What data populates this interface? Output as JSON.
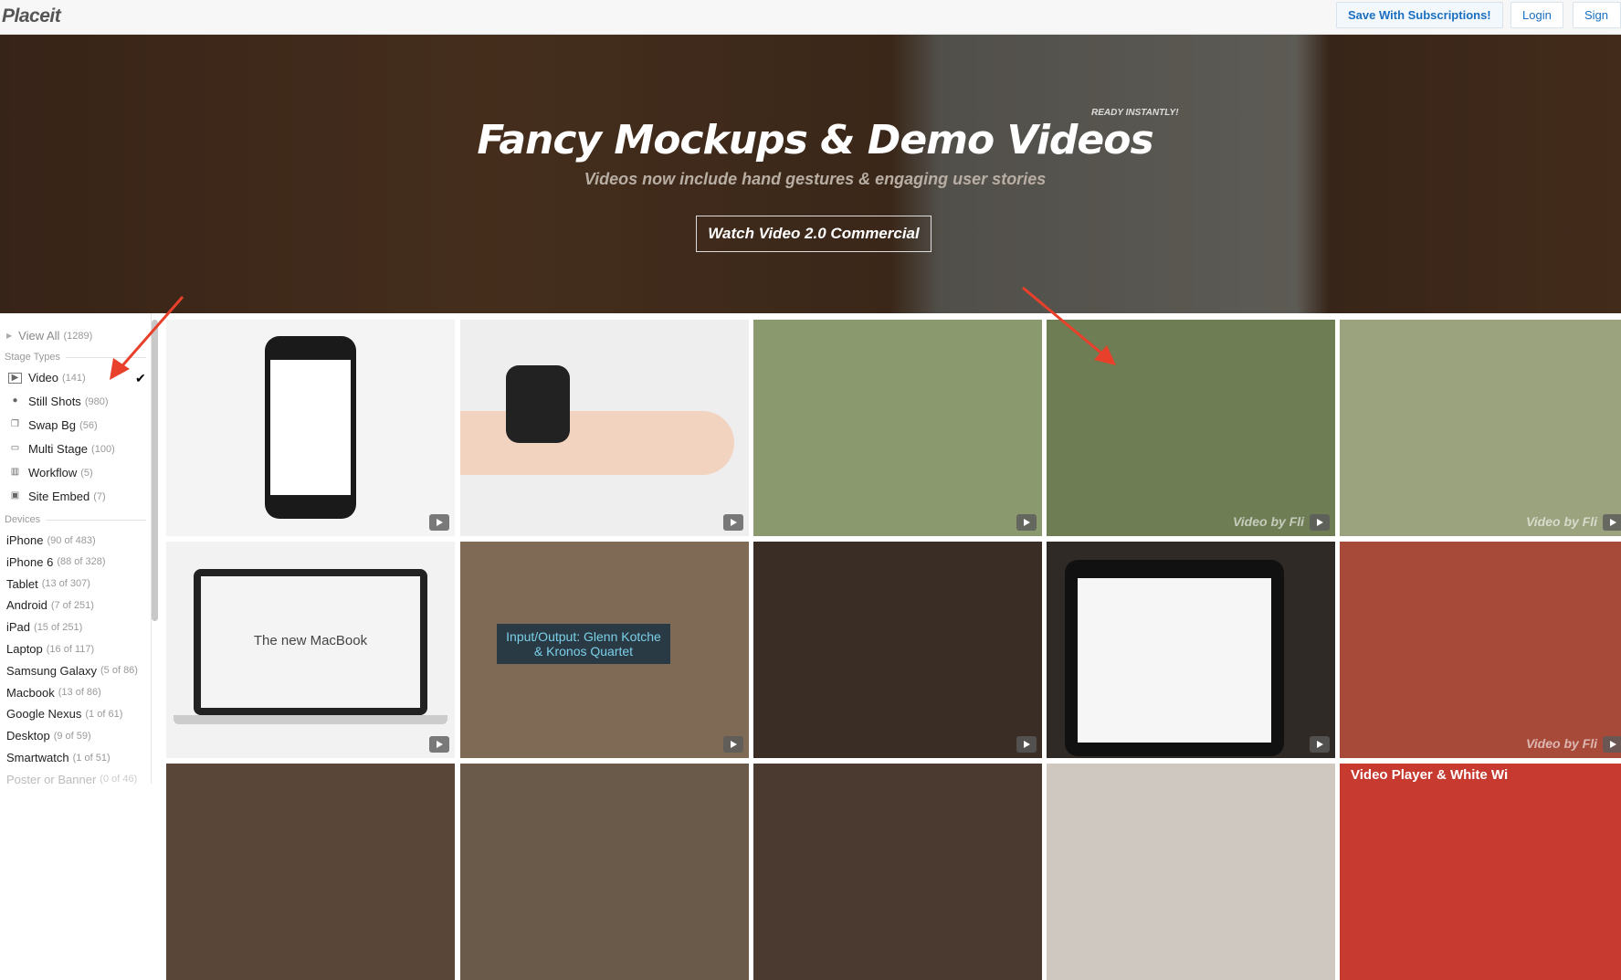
{
  "header": {
    "logo": "Placeit",
    "save_button": "Save With Subscriptions!",
    "login_button": "Login",
    "signup_button": "Sign Up"
  },
  "hero": {
    "badge": "READY INSTANTLY!",
    "title": "Fancy Mockups & Demo Videos",
    "subtitle": "Videos now include hand gestures & engaging user stories",
    "cta": "Watch Video 2.0 Commercial"
  },
  "sidebar": {
    "view_all": {
      "label": "View All",
      "count": "(1289)"
    },
    "stage_types_heading": "Stage Types",
    "stage_types": [
      {
        "label": "Video",
        "count": "(141)",
        "icon": "video-icon",
        "selected": true
      },
      {
        "label": "Still Shots",
        "count": "(980)",
        "icon": "camera-icon"
      },
      {
        "label": "Swap Bg",
        "count": "(56)",
        "icon": "layers-icon"
      },
      {
        "label": "Multi Stage",
        "count": "(100)",
        "icon": "devices-icon"
      },
      {
        "label": "Workflow",
        "count": "(5)",
        "icon": "film-icon"
      },
      {
        "label": "Site Embed",
        "count": "(7)",
        "icon": "monitor-icon"
      }
    ],
    "devices_heading": "Devices",
    "devices": [
      {
        "label": "iPhone",
        "count": "(90 of 483)"
      },
      {
        "label": "iPhone 6",
        "count": "(88 of 328)"
      },
      {
        "label": "Tablet",
        "count": "(13 of 307)"
      },
      {
        "label": "Android",
        "count": "(7 of 251)"
      },
      {
        "label": "iPad",
        "count": "(15 of 251)"
      },
      {
        "label": "Laptop",
        "count": "(16 of 117)"
      },
      {
        "label": "Samsung Galaxy",
        "count": "(5 of 86)"
      },
      {
        "label": "Macbook",
        "count": "(13 of 86)"
      },
      {
        "label": "Google Nexus",
        "count": "(1 of 61)"
      },
      {
        "label": "Desktop",
        "count": "(9 of 59)"
      },
      {
        "label": "Smartwatch",
        "count": "(1 of 51)"
      },
      {
        "label": "Poster or Banner",
        "count": "(0 of 46)",
        "disabled": true
      }
    ]
  },
  "grid": {
    "tiles": [
      {
        "bg": "#f4f4f4",
        "text": ""
      },
      {
        "bg": "#eeeeee",
        "text": ""
      },
      {
        "bg": "#8a9a6e",
        "text": ""
      },
      {
        "bg": "#6f7d55",
        "text": "Video by Fli"
      },
      {
        "bg": "#9aa37d",
        "text": "Video by Fli"
      },
      {
        "bg": "#f2f2f2",
        "text": "The new MacBook"
      },
      {
        "bg": "#7f6a55",
        "text": "Input/Output: Glenn Kotche & Kronos Quartet"
      },
      {
        "bg": "#3a2d26",
        "text": ""
      },
      {
        "bg": "#2f2a26",
        "text": ""
      },
      {
        "bg": "#a84a3a",
        "text": "Video by Fli"
      },
      {
        "bg": "#5a4638",
        "text": ""
      },
      {
        "bg": "#6a5a4a",
        "text": ""
      },
      {
        "bg": "#4a3a30",
        "text": ""
      },
      {
        "bg": "#cfc8c0",
        "text": ""
      },
      {
        "bg": "#c63a30",
        "text": "Video Player & White Wi"
      }
    ]
  }
}
